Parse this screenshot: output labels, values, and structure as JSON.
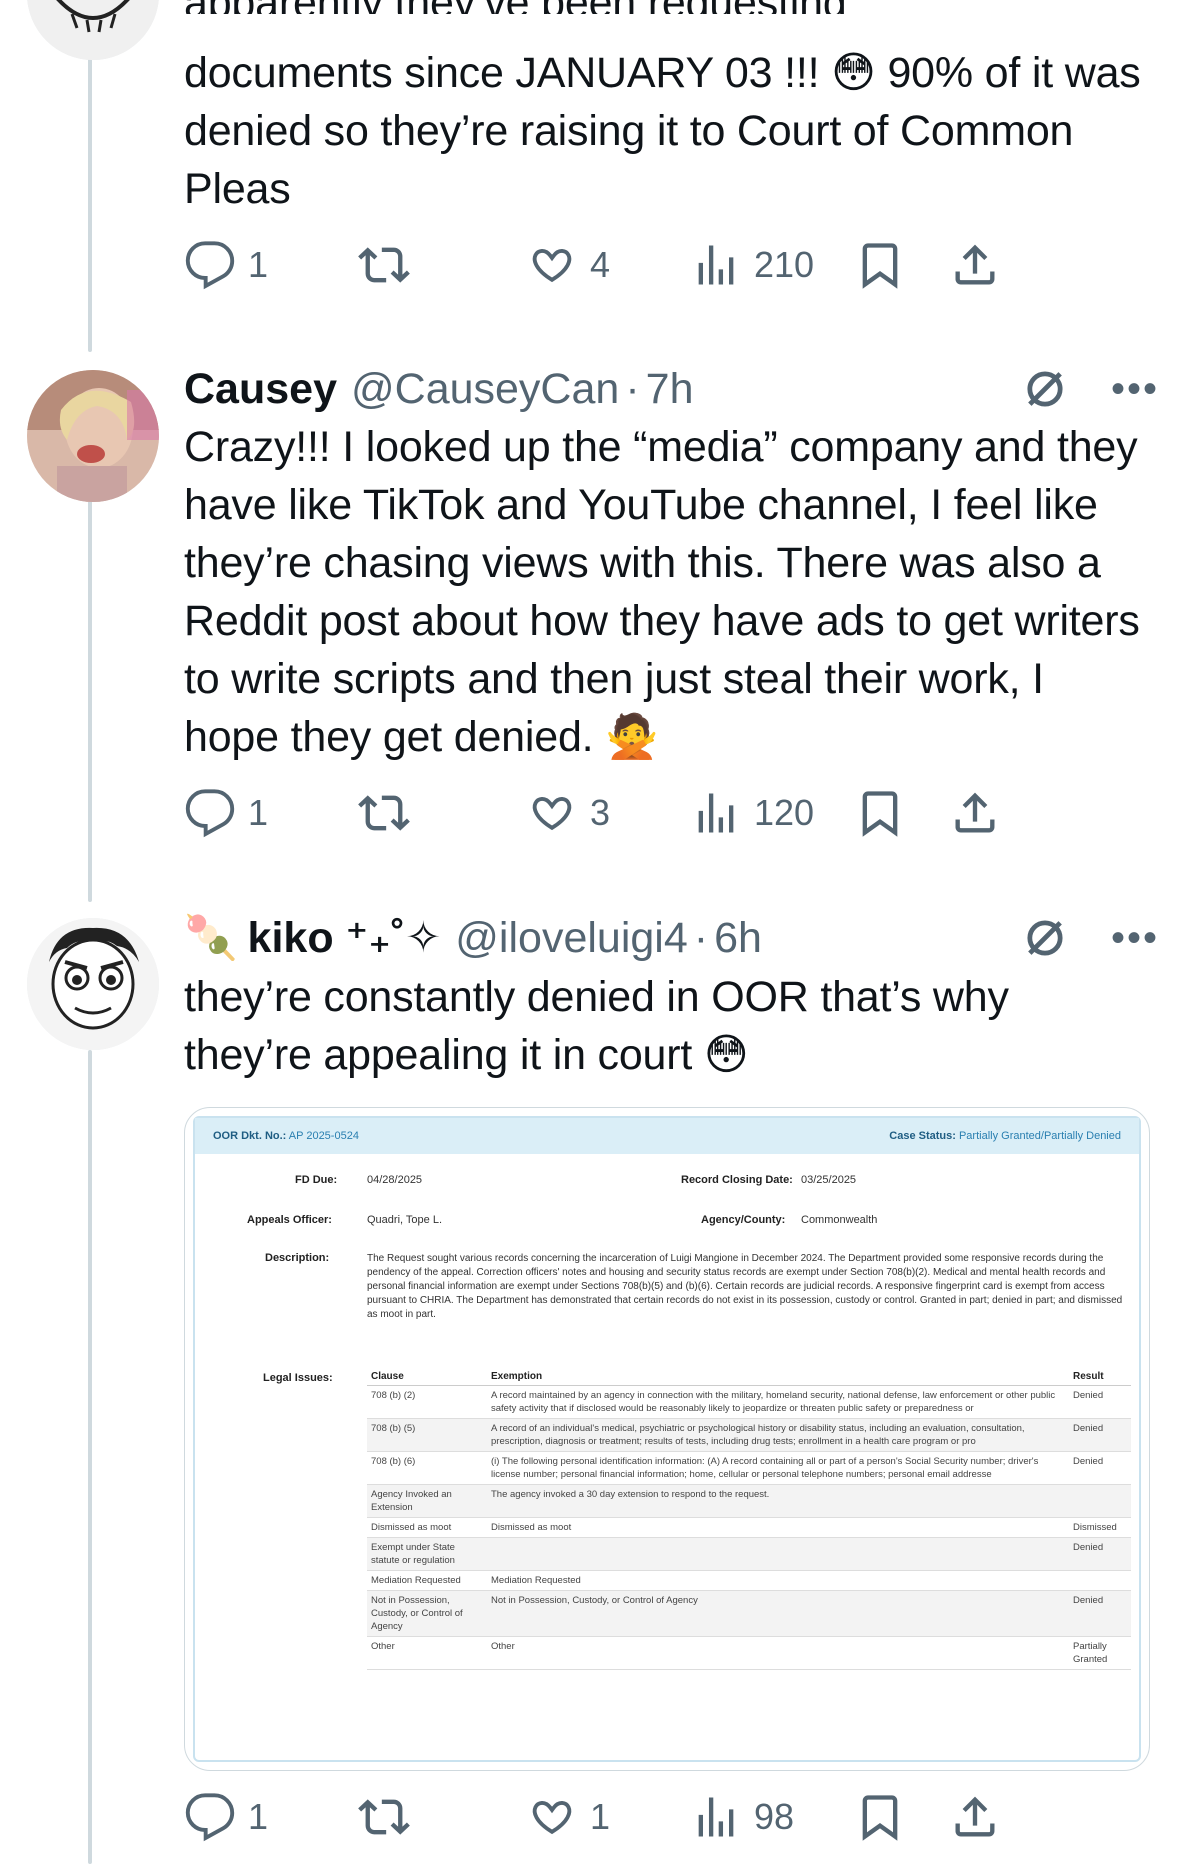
{
  "tweet1": {
    "text_partial_top": "apparently they’ve been requesting",
    "text_rest": "documents since JANUARY 03 !!! 😳 90% of it was denied so they’re raising it to Court of Common Pleas",
    "replies": "1",
    "likes": "4",
    "views": "210"
  },
  "tweet2": {
    "name": "Causey",
    "handle": "@CauseyCan",
    "time": "7h",
    "text": "Crazy!!! I looked up the “media” company and they have like TikTok and YouTube channel, I feel like they’re chasing views with this. There was also a Reddit post about how they have ads to get writers to write scripts and then just steal their work, I hope they get denied. 🙅",
    "replies": "1",
    "likes": "3",
    "views": "120"
  },
  "tweet3": {
    "name_emoji": "🍡",
    "name": "kiko ⁺₊˚✧",
    "handle": "@iloveluigi4",
    "time": "6h",
    "text": "they’re constantly denied in OOR that’s why they’re appealing it in court 😳",
    "replies": "1",
    "likes": "1",
    "views": "98"
  },
  "doc": {
    "docket_label": "OOR Dkt. No.:",
    "docket_value": "AP 2025-0524",
    "status_label": "Case Status:",
    "status_value": "Partially Granted/Partially Denied",
    "fd_due_label": "FD Due:",
    "fd_due_value": "04/28/2025",
    "closing_label": "Record Closing Date:",
    "closing_value": "03/25/2025",
    "officer_label": "Appeals Officer:",
    "officer_value": "Quadri, Tope L.",
    "agency_label": "Agency/County:",
    "agency_value": "Commonwealth",
    "desc_label": "Description:",
    "desc_value": "The Request sought various records concerning the incarceration of Luigi Mangione in December 2024. The Department provided some responsive records during the pendency of the appeal. Correction officers' notes and housing and security status records are exempt under Section 708(b)(2). Medical and mental health records and personal financial information are exempt under Sections 708(b)(5) and (b)(6). Certain records are judicial records. A responsive fingerprint card is exempt from access pursuant to CHRIA. The Department has demonstrated that certain records do not exist in its possession, custody or control. Granted in part; denied in part; and dismissed as moot in part.",
    "legal_label": "Legal Issues:",
    "legal_headers": [
      "Clause",
      "Exemption",
      "Result"
    ],
    "legal_rows": [
      {
        "clause": "708 (b) (2)",
        "exemption": "A record maintained by an agency in connection with the military, homeland security, national defense, law enforcement or other public safety activity that if disclosed would be reasonably likely to jeopardize or threaten public safety or preparedness or",
        "result": "Denied"
      },
      {
        "clause": "708 (b) (5)",
        "exemption": "A record of an individual's medical, psychiatric or psychological history or disability status, including an evaluation, consultation, prescription, diagnosis or treatment; results of tests, including drug tests; enrollment in a health care program or pro",
        "result": "Denied"
      },
      {
        "clause": "708 (b) (6)",
        "exemption": "(i) The following personal identification information: (A) A record containing all or part of a person's Social Security number; driver's license number; personal financial information; home, cellular or personal telephone numbers; personal email addresse",
        "result": "Denied"
      },
      {
        "clause": "Agency Invoked an Extension",
        "exemption": "The agency invoked a 30 day extension to respond to the request.",
        "result": ""
      },
      {
        "clause": "Dismissed as moot",
        "exemption": "Dismissed as moot",
        "result": "Dismissed"
      },
      {
        "clause": "Exempt under State statute or regulation",
        "exemption": "",
        "result": "Denied"
      },
      {
        "clause": "Mediation Requested",
        "exemption": "Mediation Requested",
        "result": ""
      },
      {
        "clause": "Not in Possession, Custody, or Control of Agency",
        "exemption": "Not in Possession, Custody, or Control of Agency",
        "result": "Denied"
      },
      {
        "clause": "Other",
        "exemption": "Other",
        "result": "Partially Granted"
      }
    ]
  },
  "icons": [
    "reply-icon",
    "retweet-icon",
    "like-icon",
    "views-icon",
    "bookmark-icon",
    "share-icon",
    "grok-icon",
    "more-icon"
  ],
  "colors": {
    "secondary_text": "#536471",
    "thread_line": "#cfd9de",
    "doc_header_bg": "#daeef7"
  }
}
